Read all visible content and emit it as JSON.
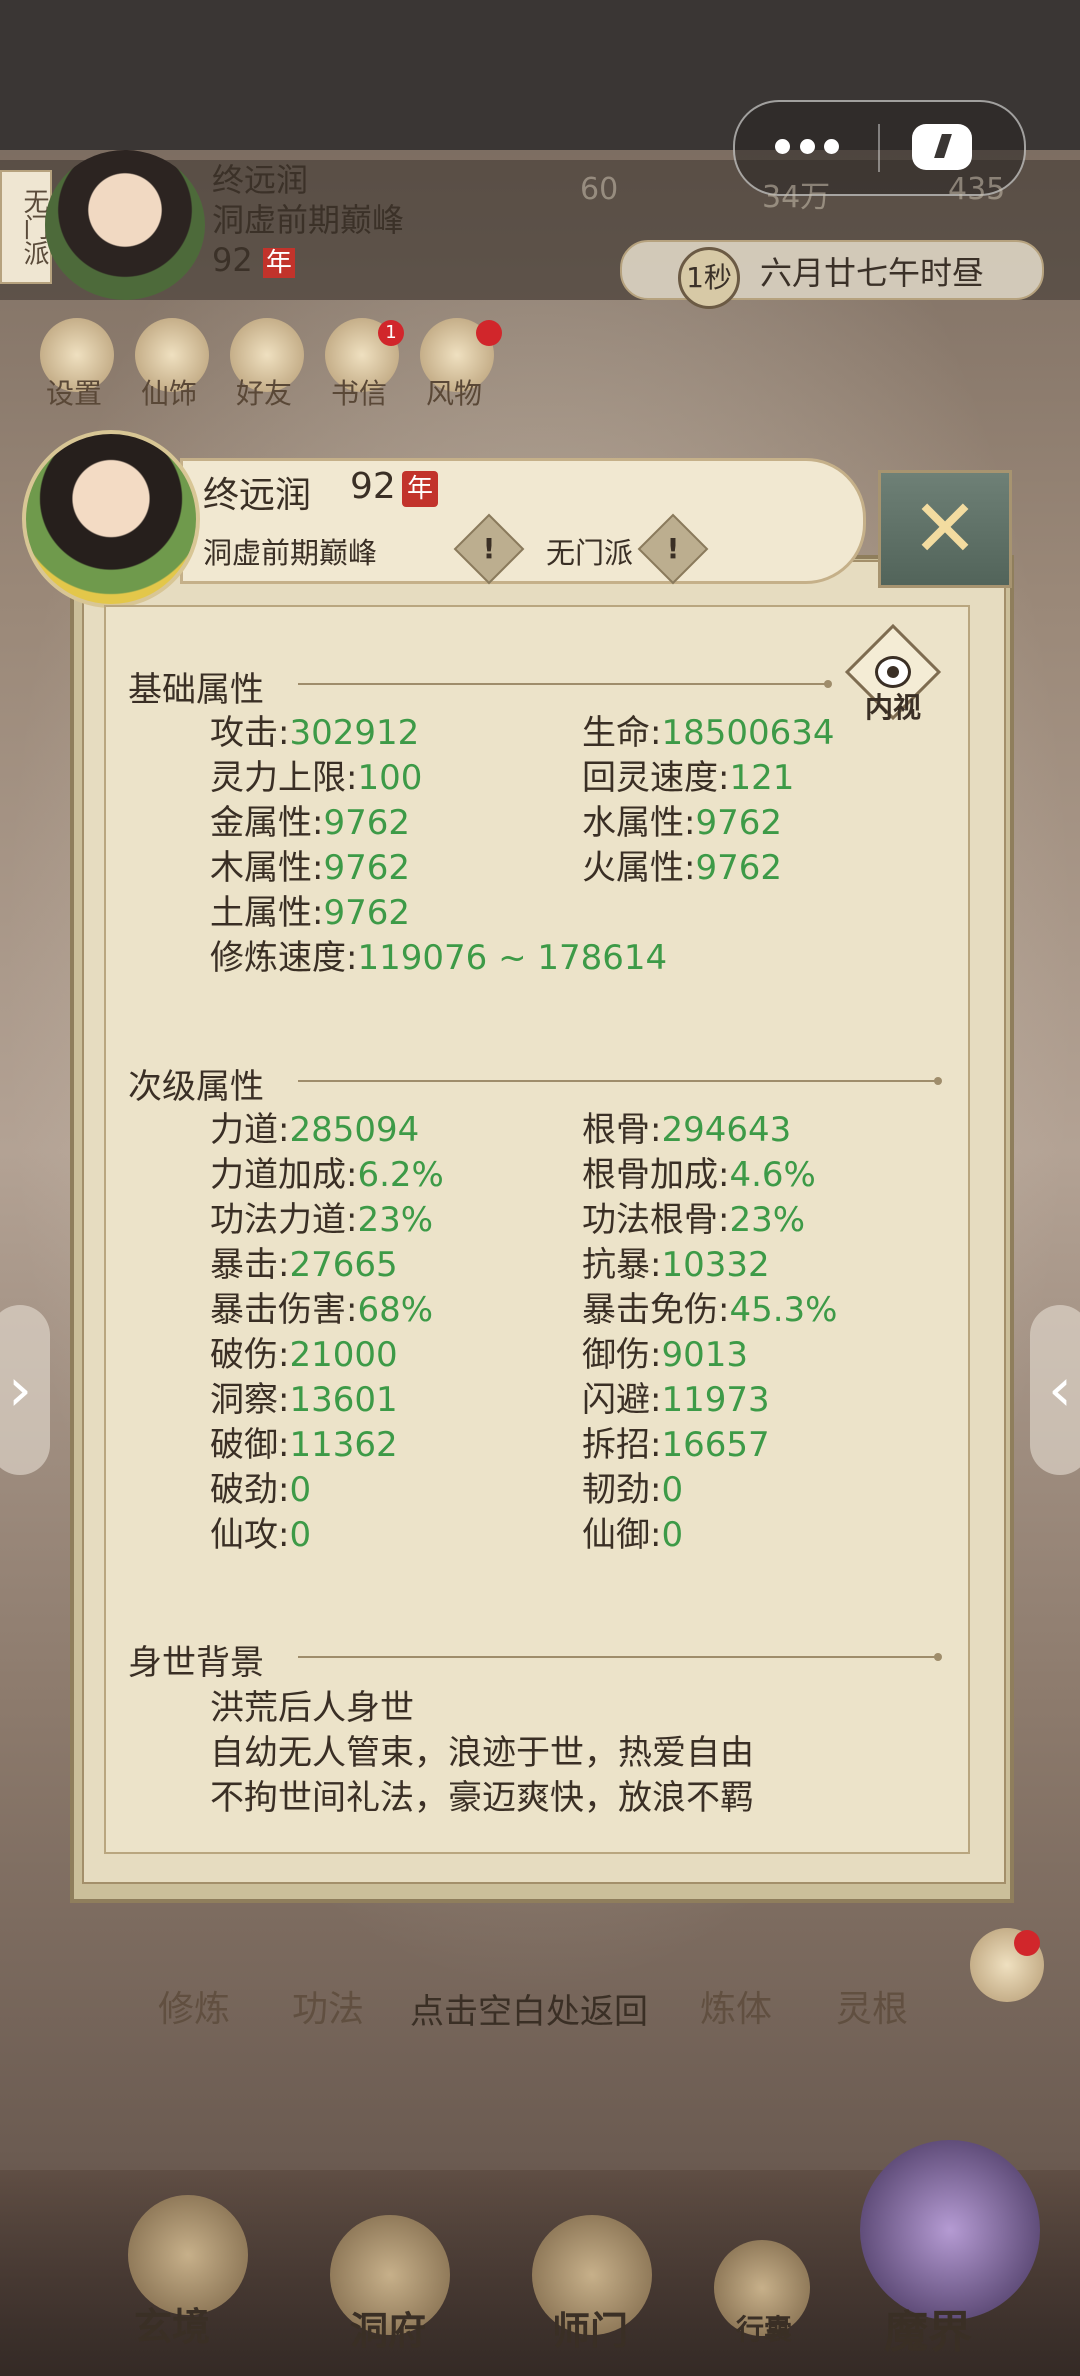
{
  "capsule": {
    "more_icon": "more-dots-icon",
    "game_icon": "gamepad-icon"
  },
  "hud": {
    "title_vertical": "无门派",
    "player_name": "终远润",
    "player_realm": "洞虚前期巅峰",
    "player_age": "92",
    "age_unit": "年",
    "res1": "60",
    "res2": "34万",
    "res3": "435",
    "time_badge": "1秒",
    "time_text": "六月廿七午时昼",
    "menu": [
      {
        "label": "设置",
        "badge": ""
      },
      {
        "label": "仙饰",
        "badge": ""
      },
      {
        "label": "好友",
        "badge": ""
      },
      {
        "label": "书信",
        "badge": "1"
      },
      {
        "label": "风物",
        "badge": ""
      }
    ]
  },
  "dialog": {
    "name": "终远润",
    "level": "92",
    "level_unit": "年",
    "realm": "洞虚前期巅峰",
    "sect": "无门派",
    "warn_symbol": "!",
    "close_symbol": "✕",
    "inner_view_label": "内视",
    "basic_title": "基础属性",
    "basic_left": [
      {
        "k": "攻击:",
        "v": "302912"
      },
      {
        "k": "灵力上限:",
        "v": "100"
      },
      {
        "k": "金属性:",
        "v": "9762"
      },
      {
        "k": "木属性:",
        "v": "9762"
      },
      {
        "k": "土属性:",
        "v": "9762"
      },
      {
        "k": "修炼速度:",
        "v": "119076 ~ 178614"
      }
    ],
    "basic_right": [
      {
        "k": "生命:",
        "v": "18500634"
      },
      {
        "k": "回灵速度:",
        "v": "121"
      },
      {
        "k": "水属性:",
        "v": "9762"
      },
      {
        "k": "火属性:",
        "v": "9762"
      }
    ],
    "secondary_title": "次级属性",
    "secondary_left": [
      {
        "k": "力道:",
        "v": "285094"
      },
      {
        "k": "力道加成:",
        "v": "6.2%"
      },
      {
        "k": "功法力道:",
        "v": "23%"
      },
      {
        "k": "暴击:",
        "v": "27665"
      },
      {
        "k": "暴击伤害:",
        "v": "68%"
      },
      {
        "k": "破伤:",
        "v": "21000"
      },
      {
        "k": "洞察:",
        "v": "13601"
      },
      {
        "k": "破御:",
        "v": "11362"
      },
      {
        "k": "破劲:",
        "v": "0"
      },
      {
        "k": "仙攻:",
        "v": "0"
      }
    ],
    "secondary_right": [
      {
        "k": "根骨:",
        "v": "294643"
      },
      {
        "k": "根骨加成:",
        "v": "4.6%"
      },
      {
        "k": "功法根骨:",
        "v": "23%"
      },
      {
        "k": "抗暴:",
        "v": "10332"
      },
      {
        "k": "暴击免伤:",
        "v": "45.3%"
      },
      {
        "k": "御伤:",
        "v": "9013"
      },
      {
        "k": "闪避:",
        "v": "11973"
      },
      {
        "k": "拆招:",
        "v": "16657"
      },
      {
        "k": "韧劲:",
        "v": "0"
      },
      {
        "k": "仙御:",
        "v": "0"
      }
    ],
    "background_title": "身世背景",
    "background_lines": [
      "洪荒后人身世",
      "自幼无人管束，浪迹于世，热爱自由",
      "不拘世间礼法，豪迈爽快，放浪不羁"
    ]
  },
  "tip": "点击空白处返回",
  "bottom_tabs": [
    "修炼",
    "功法",
    "炼体",
    "灵根"
  ],
  "bottom_nav": [
    "玄境",
    "洞府",
    "师门",
    "行囊",
    "魔界"
  ],
  "side_arrow_left": "›",
  "side_arrow_right": "‹"
}
